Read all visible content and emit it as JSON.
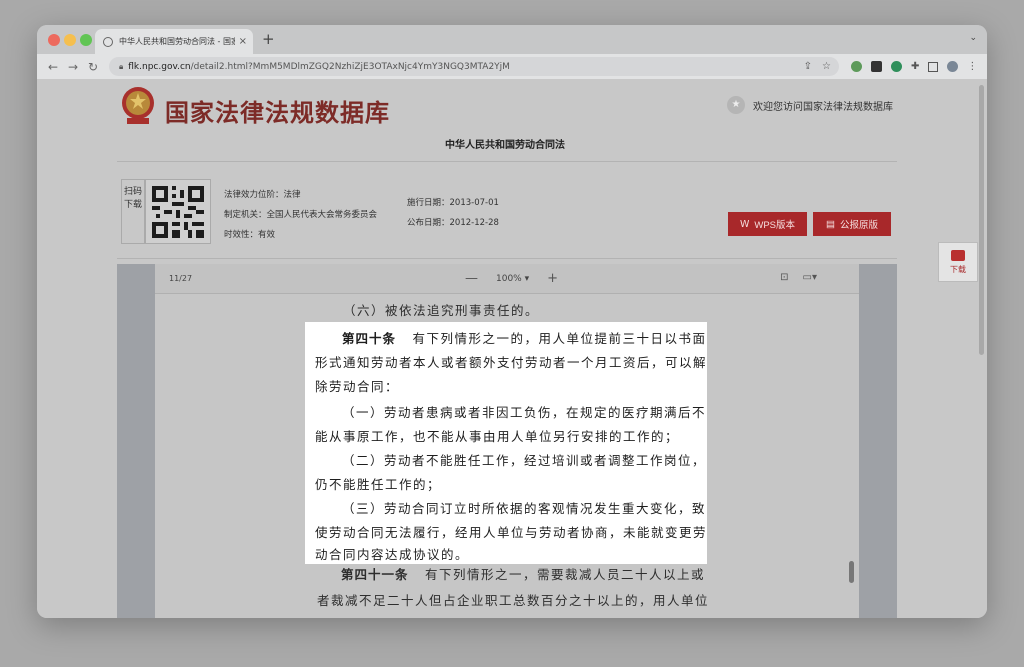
{
  "browser": {
    "tab_title": "中华人民共和国劳动合同法 - 国家",
    "url_domain": "flk.npc.gov.cn",
    "url_path": "/detail2.html?MmM5MDlmZGQ2NzhiZjE3OTAxNjc4YmY3NGQ3MTA2YjM",
    "new_tab": "+",
    "close_tab": "×"
  },
  "site": {
    "title": "国家法律法规数据库",
    "welcome": "欢迎您访问国家法律法规数据库"
  },
  "law": {
    "title": "中华人民共和国劳动合同法",
    "scan_label": "扫码下载",
    "effect_level": "法律效力位阶：法律",
    "authority": "制定机关：全国人民代表大会常务委员会",
    "validity": "时效性：有效",
    "effective_date": "施行日期：2013-07-01",
    "publish_date": "公布日期：2012-12-28",
    "wps_button": "WPS版本",
    "pdf_button": "公报原版",
    "download_label": "下载"
  },
  "viewer": {
    "page_count": "11/27",
    "zoom_out": "—",
    "zoom_level": "100%",
    "zoom_in": "+"
  },
  "document": {
    "line_prev": "（六）被依法追究刑事责任的。",
    "art40_head": "第四十条",
    "art40_l1": "有下列情形之一的，用人单位提前三十日以书面",
    "art40_l2": "形式通知劳动者本人或者额外支付劳动者一个月工资后，可以解",
    "art40_l3": "除劳动合同：",
    "item1_l1": "（一）劳动者患病或者非因工负伤，在规定的医疗期满后不",
    "item1_l2": "能从事原工作，也不能从事由用人单位另行安排的工作的；",
    "item2_l1": "（二）劳动者不能胜任工作，经过培训或者调整工作岗位，",
    "item2_l2": "仍不能胜任工作的；",
    "item3_l1": "（三）劳动合同订立时所依据的客观情况发生重大变化，致",
    "item3_l2": "使劳动合同无法履行，经用人单位与劳动者协商，未能就变更劳",
    "item3_l3": "动合同内容达成协议的。",
    "art41_head": "第四十一条",
    "art41_l1": "有下列情形之一，需要裁减人员二十人以上或",
    "art41_l2": "者裁减不足二十人但占企业职工总数百分之十以上的，用人单位"
  }
}
